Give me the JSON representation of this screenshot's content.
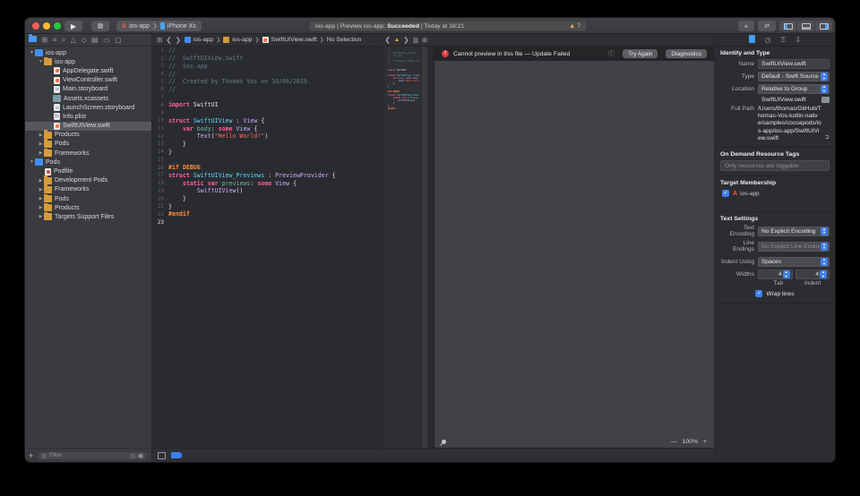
{
  "toolbar": {
    "scheme_project": "ios-app",
    "scheme_device": "iPhone Xs",
    "status_prefix": "ios-app | Preview ios-app: ",
    "status_bold": "Succeeded",
    "status_suffix": " | Today at 18:21",
    "warning_count": "7"
  },
  "navigator": {
    "filter_placeholder": "Filter",
    "files": [
      {
        "label": "ios-app",
        "icon": "project",
        "indent": 0,
        "arrow": "v"
      },
      {
        "label": "ios-app",
        "icon": "folder",
        "indent": 1,
        "arrow": "v"
      },
      {
        "label": "AppDelegate.swift",
        "icon": "swift",
        "indent": 2,
        "arrow": ""
      },
      {
        "label": "ViewController.swift",
        "icon": "swift",
        "indent": 2,
        "arrow": ""
      },
      {
        "label": "Main.storyboard",
        "icon": "sb",
        "indent": 2,
        "arrow": ""
      },
      {
        "label": "Assets.xcassets",
        "icon": "assets",
        "indent": 2,
        "arrow": ""
      },
      {
        "label": "LaunchScreen.storyboard",
        "icon": "sb",
        "indent": 2,
        "arrow": ""
      },
      {
        "label": "Info.plist",
        "icon": "plist",
        "indent": 2,
        "arrow": ""
      },
      {
        "label": "SwiftUIView.swift",
        "icon": "swift",
        "indent": 2,
        "arrow": "",
        "selected": true
      },
      {
        "label": "Products",
        "icon": "folder",
        "indent": 1,
        "arrow": ">"
      },
      {
        "label": "Pods",
        "icon": "folder",
        "indent": 1,
        "arrow": ">"
      },
      {
        "label": "Frameworks",
        "icon": "folder",
        "indent": 1,
        "arrow": ">"
      },
      {
        "label": "Pods",
        "icon": "project",
        "indent": 0,
        "arrow": "v"
      },
      {
        "label": "Podfile",
        "icon": "pod",
        "indent": 1,
        "arrow": ""
      },
      {
        "label": "Development Pods",
        "icon": "folder",
        "indent": 1,
        "arrow": ">"
      },
      {
        "label": "Frameworks",
        "icon": "folder",
        "indent": 1,
        "arrow": ">"
      },
      {
        "label": "Pods",
        "icon": "folder",
        "indent": 1,
        "arrow": ">"
      },
      {
        "label": "Products",
        "icon": "folder",
        "indent": 1,
        "arrow": ">"
      },
      {
        "label": "Targets Support Files",
        "icon": "folder",
        "indent": 1,
        "arrow": ">"
      }
    ]
  },
  "editor": {
    "breadcrumb": {
      "item1": "ios-app",
      "item2": "ios-app",
      "item3": "SwiftUIView.swift",
      "item4": "No Selection"
    },
    "code_lines": [
      {
        "n": "1",
        "t": [
          [
            "cm",
            "//"
          ]
        ]
      },
      {
        "n": "2",
        "t": [
          [
            "cm",
            "//  SwiftUIView.swift"
          ]
        ]
      },
      {
        "n": "3",
        "t": [
          [
            "cm",
            "//  ios-app"
          ]
        ]
      },
      {
        "n": "4",
        "t": [
          [
            "cm",
            "//"
          ]
        ]
      },
      {
        "n": "5",
        "t": [
          [
            "cm",
            "//  Created by Thomas Vos on 10/06/2019."
          ]
        ]
      },
      {
        "n": "6",
        "t": [
          [
            "cm",
            "//"
          ]
        ]
      },
      {
        "n": "7",
        "t": []
      },
      {
        "n": "8",
        "t": [
          [
            "kw",
            "import"
          ],
          [
            "pl",
            " SwiftUI"
          ]
        ]
      },
      {
        "n": "9",
        "t": []
      },
      {
        "n": "10",
        "t": [
          [
            "kw",
            "struct"
          ],
          [
            "pl",
            " "
          ],
          [
            "td",
            "SwiftUIView"
          ],
          [
            "pl",
            " : "
          ],
          [
            "ty",
            "View"
          ],
          [
            "pl",
            " {"
          ]
        ]
      },
      {
        "n": "11",
        "t": [
          [
            "pl",
            "    "
          ],
          [
            "kw",
            "var"
          ],
          [
            "pl",
            " "
          ],
          [
            "pr",
            "body"
          ],
          [
            "pl",
            ": "
          ],
          [
            "kw",
            "some"
          ],
          [
            "pl",
            " "
          ],
          [
            "ty",
            "View"
          ],
          [
            "pl",
            " {"
          ]
        ]
      },
      {
        "n": "12",
        "t": [
          [
            "pl",
            "        "
          ],
          [
            "ty",
            "Text"
          ],
          [
            "pl",
            "("
          ],
          [
            "st",
            "\"Hello World!\""
          ],
          [
            "pl",
            ")"
          ]
        ]
      },
      {
        "n": "13",
        "t": [
          [
            "pl",
            "    }"
          ]
        ]
      },
      {
        "n": "14",
        "t": [
          [
            "pl",
            "}"
          ]
        ]
      },
      {
        "n": "15",
        "t": []
      },
      {
        "n": "16",
        "t": [
          [
            "pp",
            "#if DEBUG"
          ]
        ]
      },
      {
        "n": "17",
        "t": [
          [
            "kw",
            "struct"
          ],
          [
            "pl",
            " "
          ],
          [
            "td",
            "SwiftUIView_Previews"
          ],
          [
            "pl",
            " : "
          ],
          [
            "ty",
            "PreviewProvider"
          ],
          [
            "pl",
            " {"
          ]
        ]
      },
      {
        "n": "18",
        "t": [
          [
            "pl",
            "    "
          ],
          [
            "kw",
            "static"
          ],
          [
            "pl",
            " "
          ],
          [
            "kw",
            "var"
          ],
          [
            "pl",
            " "
          ],
          [
            "pr",
            "previews"
          ],
          [
            "pl",
            ": "
          ],
          [
            "kw",
            "some"
          ],
          [
            "pl",
            " "
          ],
          [
            "ty",
            "View"
          ],
          [
            "pl",
            " {"
          ]
        ]
      },
      {
        "n": "19",
        "t": [
          [
            "pl",
            "        "
          ],
          [
            "ty",
            "SwiftUIView"
          ],
          [
            "pl",
            "()"
          ]
        ]
      },
      {
        "n": "20",
        "t": [
          [
            "pl",
            "    }"
          ]
        ]
      },
      {
        "n": "21",
        "t": [
          [
            "pl",
            "}"
          ]
        ]
      },
      {
        "n": "22",
        "t": [
          [
            "pp",
            "#endif"
          ]
        ]
      },
      {
        "n": "23",
        "t": [],
        "cur": true
      }
    ]
  },
  "preview": {
    "error_text": "Cannot preview in this file — Update Failed",
    "try_again_label": "Try Again",
    "diagnostics_label": "Diagnostics",
    "zoom_level": "100%",
    "zoom_out": "—",
    "zoom_in": "+"
  },
  "inspector": {
    "identity_header": "Identity and Type",
    "name_label": "Name",
    "name_value": "SwiftUIView.swift",
    "type_label": "Type",
    "type_value": "Default - Swift Source",
    "location_label": "Location",
    "location_value": "Relative to Group",
    "file_ref": "SwiftUIView.swift",
    "full_path_label": "Full Path",
    "full_path_value": "/Users/thomas/GitHub/Thomas-Vos-kotlin-native/samples/cocoapods/ios-app/ios-app/SwiftUIView.swift",
    "odr_header": "On Demand Resource Tags",
    "odr_placeholder": "Only resources are taggable",
    "target_header": "Target Membership",
    "target_name": "ios-app",
    "text_settings_header": "Text Settings",
    "text_encoding_label": "Text Encoding",
    "text_encoding_value": "No Explicit Encoding",
    "line_endings_label": "Line Endings",
    "line_endings_value": "No Explicit Line Endings",
    "indent_label": "Indent Using",
    "indent_value": "Spaces",
    "widths_label": "Widths",
    "tab_width": "4",
    "indent_width": "4",
    "tab_caption": "Tab",
    "indent_caption": "Indent",
    "wrap_label": "Wrap lines"
  },
  "colors": {
    "accent": "#3f7ef2",
    "warning": "#f2b13c",
    "error": "#e0383e",
    "selection": "#55575c"
  }
}
